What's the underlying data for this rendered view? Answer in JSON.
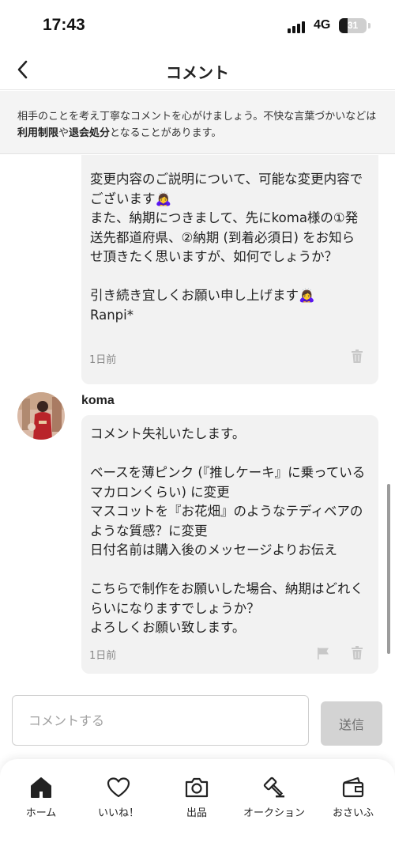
{
  "status_bar": {
    "time": "17:43",
    "network": "4G",
    "battery": "31",
    "battery_level": 0.31
  },
  "header": {
    "title": "コメント",
    "back_icon": "chevron-left-icon"
  },
  "notice": {
    "text_1": "相手のことを考え丁寧なコメントを心がけましょう。不快な言葉づかいなどは",
    "link_1": "利用制限",
    "text_2": "や",
    "link_2": "退会処分",
    "text_3": "となることがあります。"
  },
  "comments": [
    {
      "author": "",
      "text": "変更内容のご説明について、可能な変更内容でございます🙇‍♀️\nまた、納期につきまして、先にkoma様の①発送先都道府県、②納期 (到着必須日) をお知らせ頂きたく思いますが、如何でしょうか？\n\n引き続き宜しくお願い申し上げます🙇‍♀️\nRanpi*",
      "time": "1日前"
    },
    {
      "author": "koma",
      "text": "コメント失礼いたします。\n\nベースを薄ピンク (『推しケーキ』に乗っているマカロンくらい) に変更\nマスコットを『お花畑』のようなテディベアのような質感？に変更\n日付名前は購入後のメッセージよりお伝え\n\nこちらで制作をお願いした場合、納期はどれくらいになりますでしょうか？\nよろしくお願い致します。",
      "time": "1日前"
    }
  ],
  "input": {
    "placeholder": "コメントする",
    "send_label": "送信"
  },
  "tab_bar": {
    "tabs": [
      {
        "label": "ホーム",
        "icon": "home-icon"
      },
      {
        "label": "いいね！",
        "icon": "heart-icon"
      },
      {
        "label": "出品",
        "icon": "camera-icon"
      },
      {
        "label": "オークション",
        "icon": "gavel-icon"
      },
      {
        "label": "おさいふ",
        "icon": "wallet-icon"
      }
    ]
  },
  "colors": {
    "bubble": "#f2f2f2",
    "notice_bg": "#f4f4f4",
    "send_button": "#d3d3d3",
    "text": "#222222"
  }
}
